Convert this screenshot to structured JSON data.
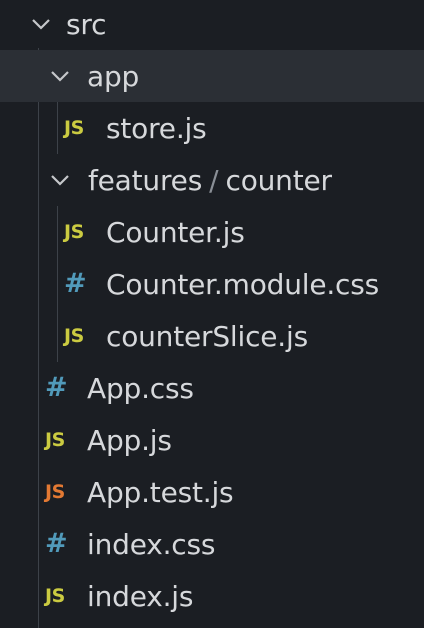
{
  "tree": {
    "root": {
      "label": "src",
      "expanded": true
    },
    "app_folder": {
      "label": "app",
      "expanded": true
    },
    "app_files": [
      {
        "label": "store.js",
        "icon": "js-icon",
        "badge": "JS"
      }
    ],
    "features_folder": {
      "label_parent": "features",
      "separator": "/",
      "label_child": "counter",
      "expanded": true
    },
    "features_files": [
      {
        "label": "Counter.js",
        "icon": "js-icon",
        "badge": "JS"
      },
      {
        "label": "Counter.module.css",
        "icon": "css-icon",
        "badge": "#"
      },
      {
        "label": "counterSlice.js",
        "icon": "js-icon",
        "badge": "JS"
      }
    ],
    "src_files": [
      {
        "label": "App.css",
        "icon": "css-icon",
        "badge": "#"
      },
      {
        "label": "App.js",
        "icon": "js-icon",
        "badge": "JS"
      },
      {
        "label": "App.test.js",
        "icon": "test-js-icon",
        "badge": "JS"
      },
      {
        "label": "index.css",
        "icon": "css-icon",
        "badge": "#"
      },
      {
        "label": "index.js",
        "icon": "js-icon",
        "badge": "JS"
      }
    ]
  },
  "colors": {
    "background": "#1b1e23",
    "highlight": "#2b2f35",
    "text": "#d6d8db",
    "js_icon": "#cbcb41",
    "test_js_icon": "#e37933",
    "css_icon": "#519aba",
    "guide": "#3d4249"
  }
}
